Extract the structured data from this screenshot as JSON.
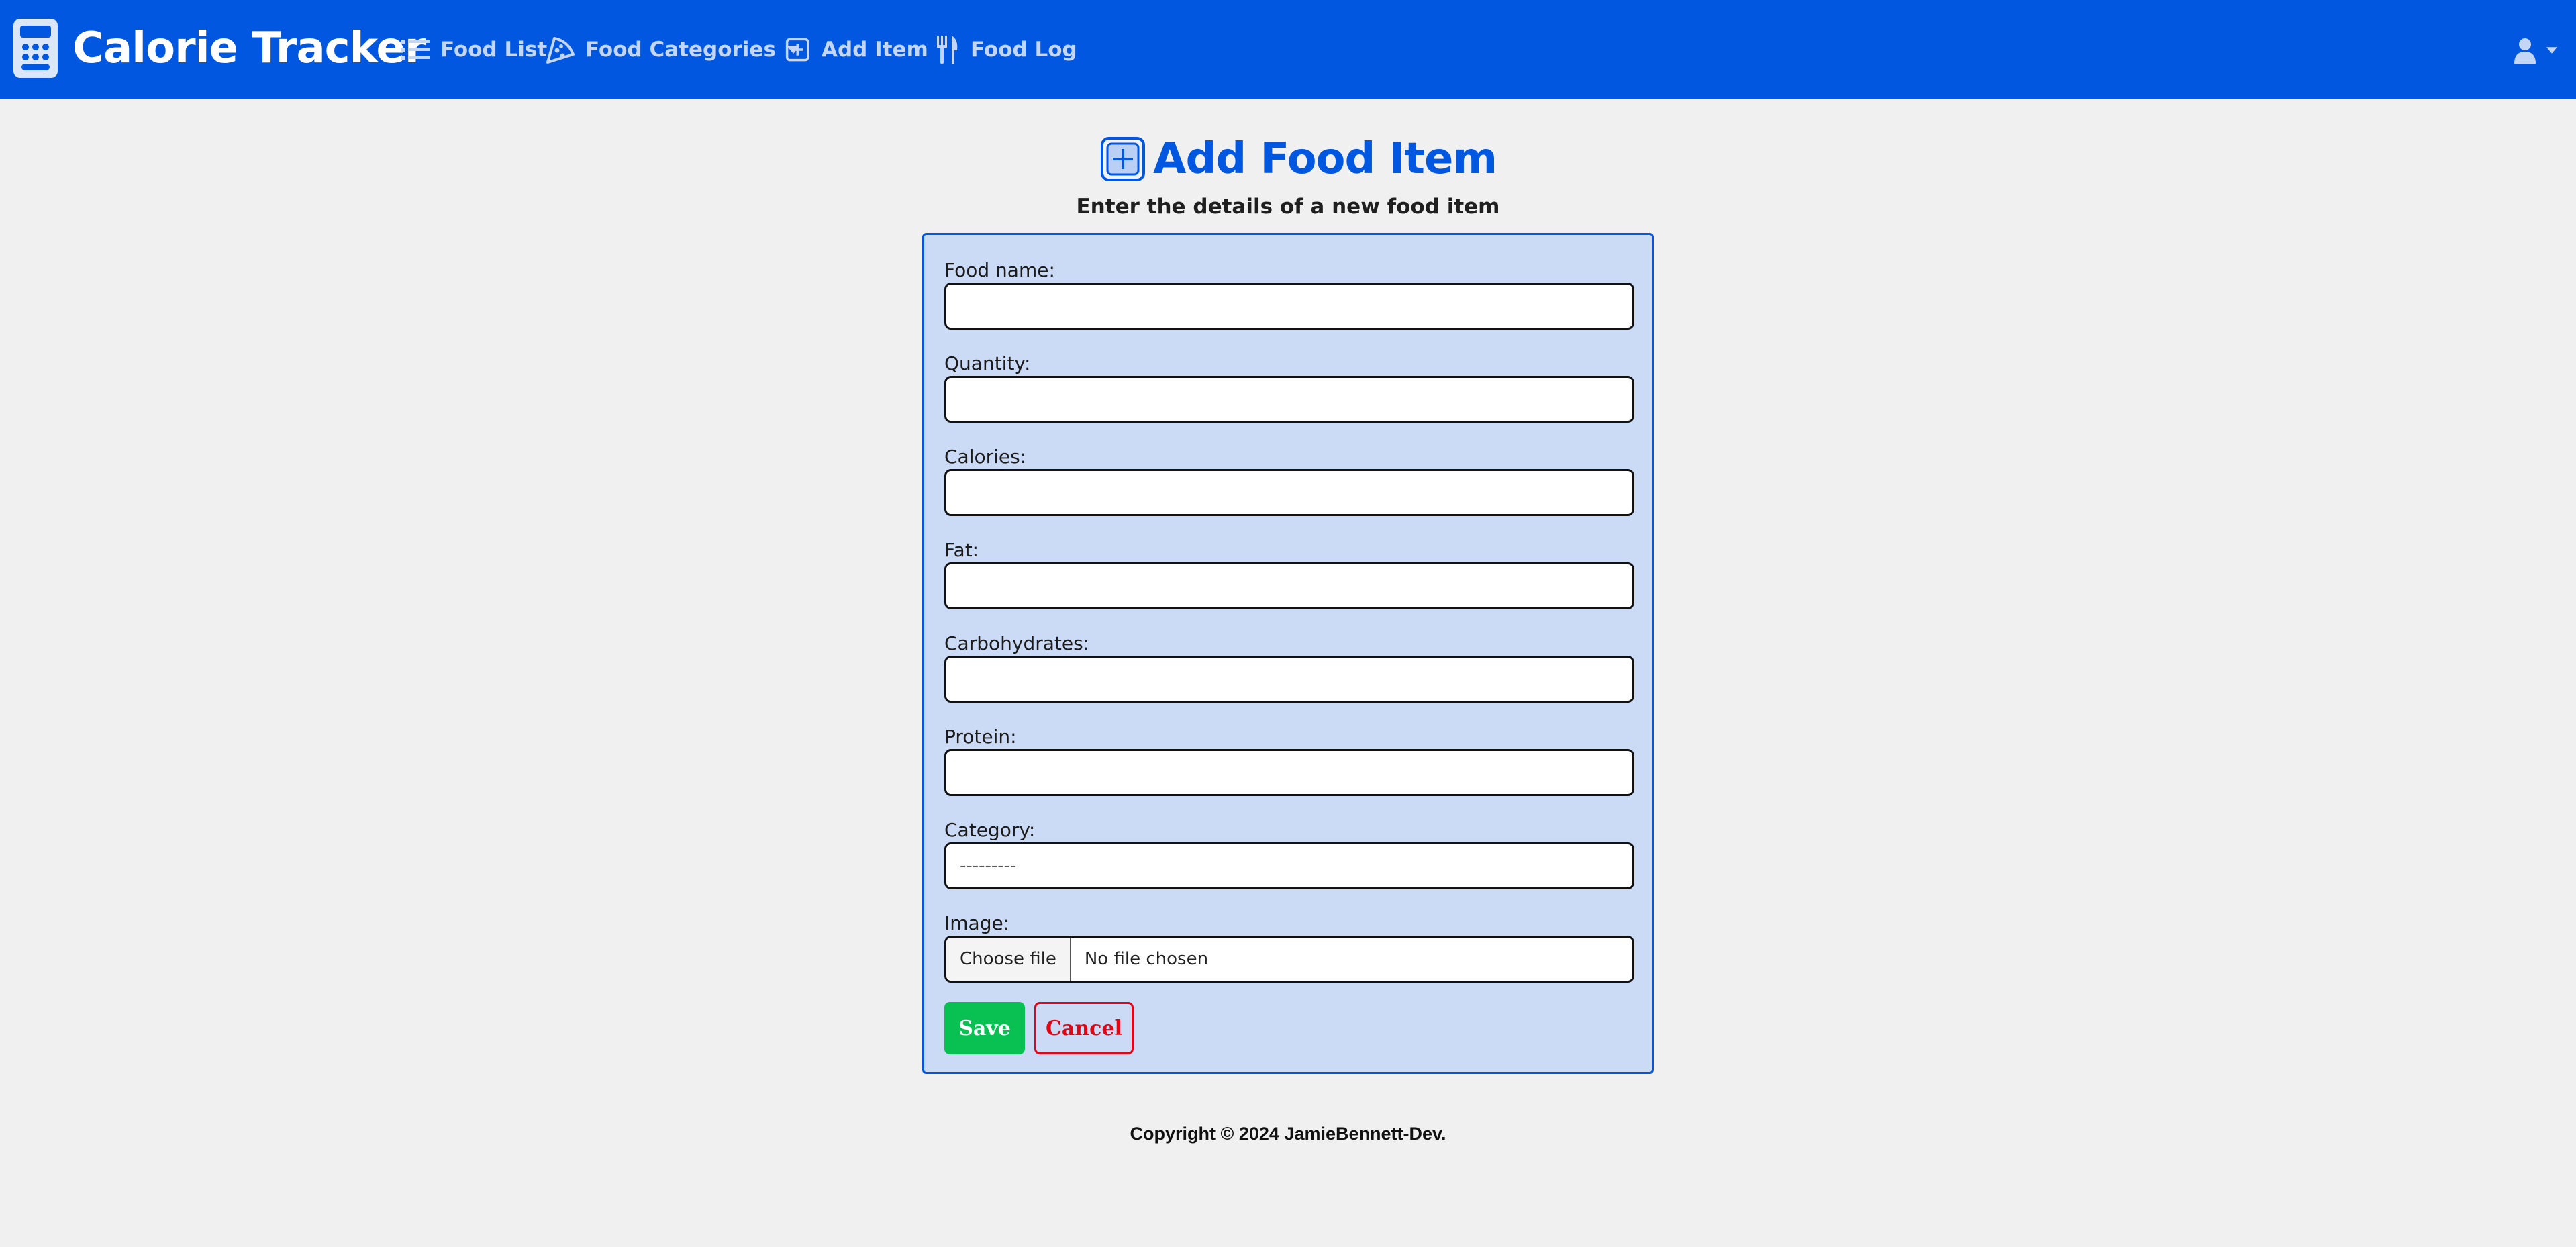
{
  "colors": {
    "navbar_bg": "#0157e0",
    "nav_text": "#c4d6f5",
    "accent": "#0157e0",
    "card_bg": "#cbdbf6",
    "save_green": "#09c153",
    "cancel_red": "#e10613"
  },
  "navbar": {
    "brand": {
      "icon": "calculator-icon",
      "title": "Calorie Tracker"
    },
    "items": [
      {
        "icon": "list-icon",
        "label": "Food List"
      },
      {
        "icon": "pizza-icon",
        "label": "Food Categories",
        "dropdown": true
      },
      {
        "icon": "plus-square-icon",
        "label": "Add Item"
      },
      {
        "icon": "utensils-icon",
        "label": "Food Log"
      }
    ],
    "user_menu": {
      "icon": "user-icon",
      "dropdown": true
    }
  },
  "page": {
    "title_icon": "plus-square-icon",
    "title": "Add Food Item",
    "subtitle": "Enter the details of a new food item"
  },
  "form": {
    "fields": [
      {
        "label": "Food name:",
        "value": ""
      },
      {
        "label": "Quantity:",
        "value": ""
      },
      {
        "label": "Calories:",
        "value": ""
      },
      {
        "label": "Fat:",
        "value": ""
      },
      {
        "label": "Carbohydrates:",
        "value": ""
      },
      {
        "label": "Protein:",
        "value": ""
      }
    ],
    "category": {
      "label": "Category:",
      "selected": "---------"
    },
    "image": {
      "label": "Image:",
      "button": "Choose file",
      "status": "No file chosen"
    },
    "save_label": "Save",
    "cancel_label": "Cancel"
  },
  "footer": {
    "text": "Copyright © 2024 JamieBennett-Dev."
  }
}
